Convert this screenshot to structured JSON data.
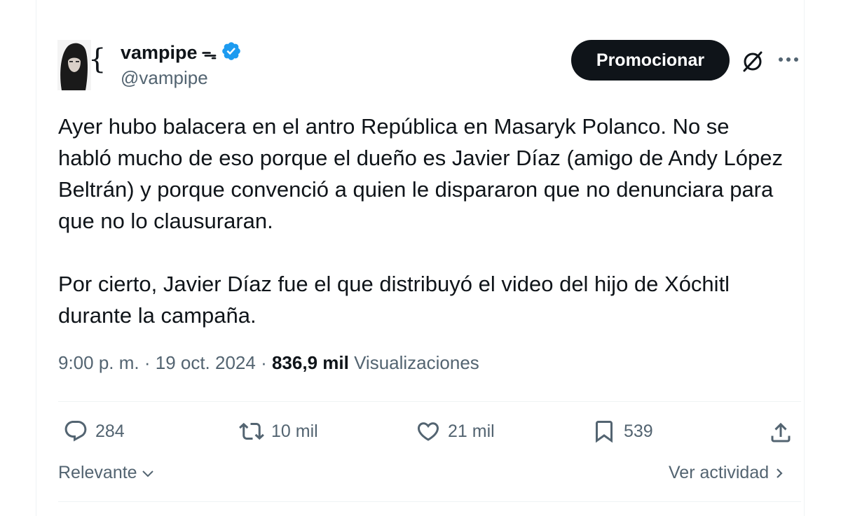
{
  "author": {
    "name": "vampipe",
    "name_suffix": "ᯓ",
    "handle": "@vampipe",
    "verified": true
  },
  "header": {
    "promote_label": "Promocionar",
    "grok_icon": "slashed-circle-icon",
    "more_icon": "more-dots-icon"
  },
  "tweet": {
    "paragraph_1": "Ayer hubo balacera en el antro República en Masaryk Polanco. No se habló mucho de eso porque el dueño es Javier Díaz (amigo de Andy López Beltrán) y porque convenció a quien le dispararon que no denunciara para que no lo clausuraran.",
    "paragraph_2": "Por cierto, Javier Díaz fue el que distribuyó el video del hijo de Xóchitl durante la campaña."
  },
  "meta": {
    "time": "9:00 p. m.",
    "sep1": " · ",
    "date": "19 oct. 2024",
    "sep2": " · ",
    "views_count": "836,9 mil",
    "views_label": "Visualizaciones"
  },
  "actions": {
    "replies": "284",
    "reposts": "10 mil",
    "likes": "21 mil",
    "bookmarks": "539"
  },
  "footer": {
    "sort_label": "Relevante",
    "activity_label": "Ver actividad"
  },
  "colors": {
    "verified": "#1d9bf0",
    "text_primary": "#0f1419",
    "text_secondary": "#536471"
  }
}
